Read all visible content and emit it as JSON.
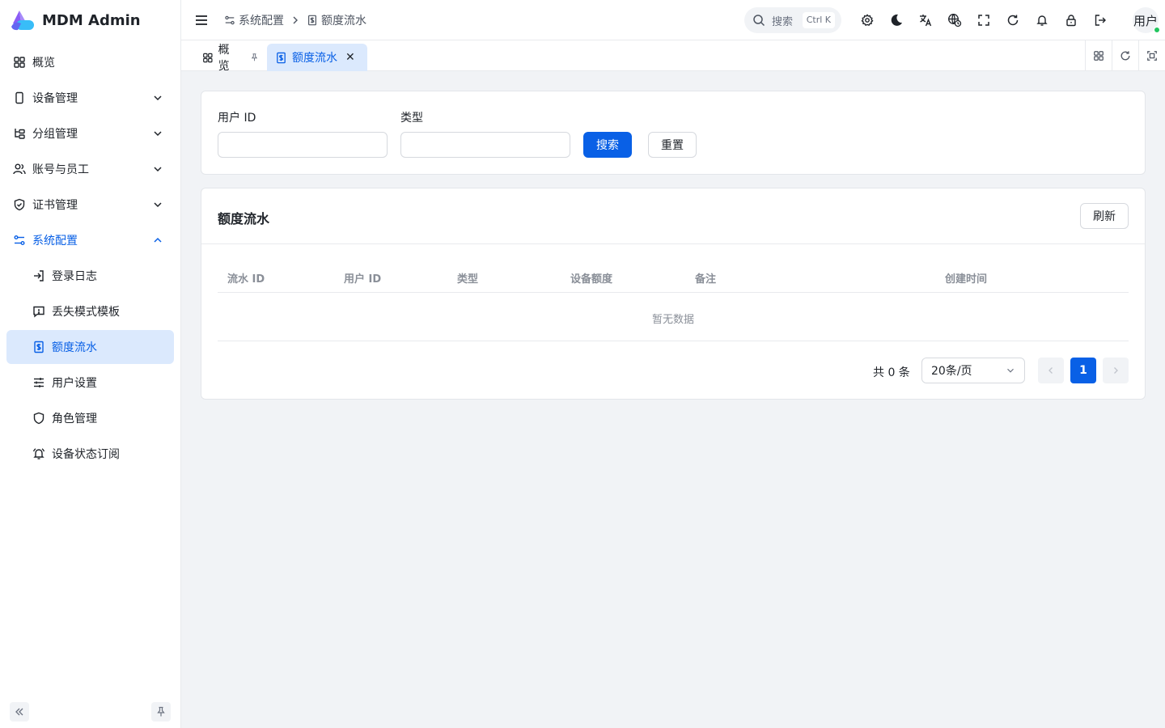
{
  "app": {
    "title": "MDM Admin"
  },
  "sidebar": {
    "items": [
      {
        "label": "概览"
      },
      {
        "label": "设备管理"
      },
      {
        "label": "分组管理"
      },
      {
        "label": "账号与员工"
      },
      {
        "label": "证书管理"
      },
      {
        "label": "系统配置"
      }
    ],
    "subitems": [
      {
        "label": "登录日志"
      },
      {
        "label": "丢失模式模板"
      },
      {
        "label": "额度流水"
      },
      {
        "label": "用户设置"
      },
      {
        "label": "角色管理"
      },
      {
        "label": "设备状态订阅"
      }
    ]
  },
  "header": {
    "breadcrumb": [
      "系统配置",
      "额度流水"
    ],
    "search_placeholder": "搜索",
    "search_shortcut": "Ctrl K",
    "user_label": "用户"
  },
  "tabs": [
    {
      "label": "概览"
    },
    {
      "label": "额度流水"
    }
  ],
  "filter": {
    "user_id_label": "用户 ID",
    "type_label": "类型",
    "search_button": "搜索",
    "reset_button": "重置"
  },
  "list": {
    "title": "额度流水",
    "refresh_button": "刷新",
    "columns": [
      "流水 ID",
      "用户 ID",
      "类型",
      "设备额度",
      "备注",
      "创建时间"
    ],
    "empty_text": "暂无数据",
    "total_text": "共 0 条",
    "page_size": "20条/页",
    "current_page": "1"
  },
  "colors": {
    "primary": "#0960e6",
    "active_bg": "#dbe9fd",
    "online": "#22c55e"
  }
}
